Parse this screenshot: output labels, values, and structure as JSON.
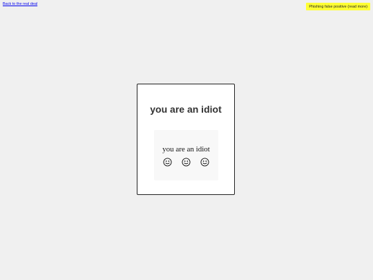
{
  "back_link": {
    "label": "Back to the real deal"
  },
  "badge": {
    "label": "Phishing false positive (read more)",
    "color": "#ffff33"
  },
  "card": {
    "title": "you are an idiot",
    "inner": {
      "text": "you are an idiot",
      "icons": [
        "smiley-face-icon",
        "smiley-face-icon",
        "smiley-face-icon"
      ]
    }
  },
  "colors": {
    "page_background": "#f0f0f0",
    "card_background": "#ffffff",
    "card_border": "#202020"
  }
}
